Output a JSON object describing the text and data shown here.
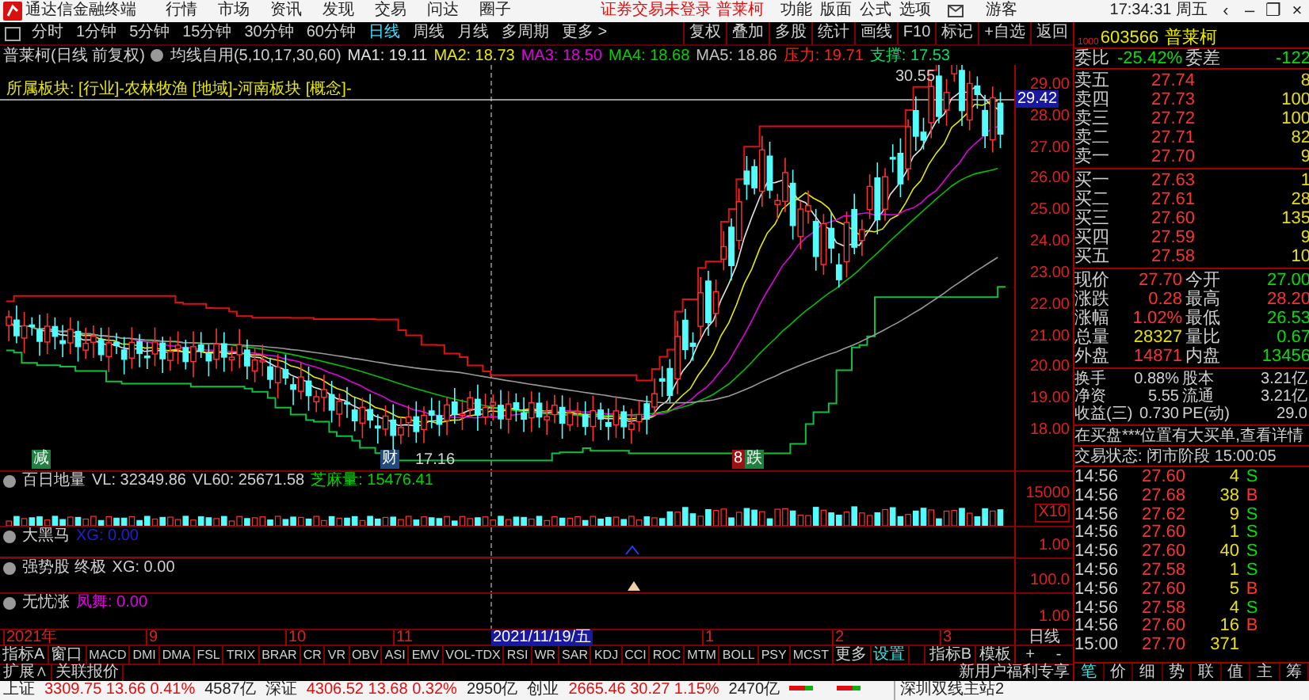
{
  "app_title": "通达信金融终端",
  "menu": [
    "行情",
    "市场",
    "资讯",
    "发现",
    "交易",
    "问达",
    "圈子"
  ],
  "login_notice": "证券交易未登录 普莱柯",
  "top_menu": [
    "功能",
    "版面",
    "公式",
    "选项"
  ],
  "user": "游客",
  "clock": "17:34:31 周五",
  "window_controls": [
    "‹",
    "–",
    "❐",
    "×"
  ],
  "periods": [
    {
      "label": "分时",
      "selected": false
    },
    {
      "label": "1分钟",
      "selected": false
    },
    {
      "label": "5分钟",
      "selected": false
    },
    {
      "label": "15分钟",
      "selected": false
    },
    {
      "label": "30分钟",
      "selected": false
    },
    {
      "label": "60分钟",
      "selected": false
    },
    {
      "label": "日线",
      "selected": true
    },
    {
      "label": "周线",
      "selected": false
    },
    {
      "label": "月线",
      "selected": false
    },
    {
      "label": "多周期",
      "selected": false
    },
    {
      "label": "更多 >",
      "selected": false
    }
  ],
  "chart_tools": [
    "复权",
    "叠加",
    "多股",
    "统计",
    "画线",
    "F10",
    "标记",
    "+自选",
    "返回"
  ],
  "chart_header": {
    "title": "普莱柯(日线 前复权)",
    "indicator": "均线自用(5,10,17,30,60)",
    "values": [
      {
        "text": "MA1: 19.11",
        "color": "#e0e0e0"
      },
      {
        "text": "MA2: 18.73",
        "color": "#e8e800"
      },
      {
        "text": "MA3: 18.50",
        "color": "#e000e0"
      },
      {
        "text": "MA4: 18.68",
        "color": "#00d000"
      },
      {
        "text": "MA5: 18.86",
        "color": "#c0c0c0"
      },
      {
        "text": "压力: 19.71",
        "color": "#ff2020"
      },
      {
        "text": "支撑: 17.53",
        "color": "#00e060"
      }
    ]
  },
  "sector_line": "所属板块: [行业]-农林牧渔 [地域]-河南板块 [概念]-",
  "price_axis": [
    "29.00",
    "28.00",
    "27.00",
    "26.00",
    "25.00",
    "24.00",
    "23.00",
    "22.00",
    "21.00",
    "20.00",
    "19.00",
    "18.00"
  ],
  "price_tag": "29.42",
  "high_label": "30.55",
  "low_label": "17.16",
  "event_marks": [
    {
      "text": "减",
      "color": "#208040"
    },
    {
      "text": "财",
      "color": "#204a80"
    },
    {
      "text": "8",
      "color": "#a01010"
    },
    {
      "text": "跌",
      "color": "#208040"
    }
  ],
  "panels": [
    {
      "name": "百日地量",
      "values": [
        {
          "text": "VL: 32349.86",
          "color": "#d0d0d0"
        },
        {
          "text": "VL60: 25671.58",
          "color": "#d0d0d0"
        },
        {
          "text": "芝麻量: 15476.41",
          "color": "#00d000"
        }
      ],
      "axis": [
        "15000",
        "X10"
      ]
    },
    {
      "name": "大黑马",
      "values": [
        {
          "text": "XG: 0.00",
          "color": "#2020d0"
        }
      ],
      "axis": [
        "1.00"
      ]
    },
    {
      "name": "强势股 终极",
      "values": [
        {
          "text": "XG: 0.00",
          "color": "#d0d0d0"
        }
      ],
      "axis": [
        "100.0"
      ]
    },
    {
      "name": "无忧涨",
      "values": [
        {
          "text": "凤舞: 0.00",
          "color": "#e000e0"
        }
      ],
      "axis": [
        "1.00"
      ]
    }
  ],
  "date_axis": [
    "2021年",
    "9",
    "10",
    "11",
    "1",
    "2",
    "3"
  ],
  "cursor_date": "2021/11/19/五",
  "axis_period": "日线",
  "zoom_buttons": [
    "+",
    "-"
  ],
  "indicator_tabs": [
    {
      "label": "指标A",
      "highlighted": false
    },
    {
      "label": "窗口",
      "highlighted": false
    },
    {
      "label": "MACD",
      "highlighted": false
    },
    {
      "label": "DMI",
      "highlighted": false
    },
    {
      "label": "DMA",
      "highlighted": false
    },
    {
      "label": "FSL",
      "highlighted": false
    },
    {
      "label": "TRIX",
      "highlighted": false
    },
    {
      "label": "BRAR",
      "highlighted": false
    },
    {
      "label": "CR",
      "highlighted": false
    },
    {
      "label": "VR",
      "highlighted": false
    },
    {
      "label": "OBV",
      "highlighted": false
    },
    {
      "label": "ASI",
      "highlighted": false
    },
    {
      "label": "EMV",
      "highlighted": false
    },
    {
      "label": "VOL-TDX",
      "highlighted": false
    },
    {
      "label": "RSI",
      "highlighted": false
    },
    {
      "label": "WR",
      "highlighted": false
    },
    {
      "label": "SAR",
      "highlighted": false
    },
    {
      "label": "KDJ",
      "highlighted": false
    },
    {
      "label": "CCI",
      "highlighted": false
    },
    {
      "label": "ROC",
      "highlighted": false
    },
    {
      "label": "MTM",
      "highlighted": false
    },
    {
      "label": "BOLL",
      "highlighted": false
    },
    {
      "label": "PSY",
      "highlighted": false
    },
    {
      "label": "MCST",
      "highlighted": false
    },
    {
      "label": "更多",
      "highlighted": false
    },
    {
      "label": "设置",
      "highlighted": true
    }
  ],
  "indicator_tabs_right": [
    "指标B",
    "模板"
  ],
  "extra_tabs": [
    "扩展∧",
    "关联报价"
  ],
  "promo": "新用户福利专享",
  "stock": {
    "badge": "1000",
    "code": "603566",
    "name": "普莱柯"
  },
  "ratio": {
    "label": "委比",
    "value": "-25.42%",
    "label2": "委差",
    "value2": "-122"
  },
  "asks": [
    {
      "label": "卖五",
      "price": "27.74",
      "volume": "8"
    },
    {
      "label": "卖四",
      "price": "27.73",
      "volume": "100"
    },
    {
      "label": "卖三",
      "price": "27.72",
      "volume": "100"
    },
    {
      "label": "卖二",
      "price": "27.71",
      "volume": "82"
    },
    {
      "label": "卖一",
      "price": "27.70",
      "volume": "9"
    }
  ],
  "bids": [
    {
      "label": "买一",
      "price": "27.63",
      "volume": "1"
    },
    {
      "label": "买二",
      "price": "27.61",
      "volume": "28"
    },
    {
      "label": "买三",
      "price": "27.60",
      "volume": "135"
    },
    {
      "label": "买四",
      "price": "27.59",
      "volume": "9"
    },
    {
      "label": "买五",
      "price": "27.58",
      "volume": "10"
    }
  ],
  "stats": [
    {
      "cells": [
        {
          "label": "现价",
          "value": "27.70",
          "color": "#ff3030"
        },
        {
          "label": "今开",
          "value": "27.00",
          "color": "#00e000"
        }
      ]
    },
    {
      "cells": [
        {
          "label": "涨跌",
          "value": "0.28",
          "color": "#ff3030"
        },
        {
          "label": "最高",
          "value": "28.20",
          "color": "#ff3030"
        }
      ]
    },
    {
      "cells": [
        {
          "label": "涨幅",
          "value": "1.02%",
          "color": "#ff3030"
        },
        {
          "label": "最低",
          "value": "26.53",
          "color": "#00e000"
        }
      ]
    },
    {
      "cells": [
        {
          "label": "总量",
          "value": "28327",
          "color": "#e8e000"
        },
        {
          "label": "量比",
          "value": "0.67",
          "color": "#00e000"
        }
      ]
    },
    {
      "cells": [
        {
          "label": "外盘",
          "value": "14871",
          "color": "#ff3030"
        },
        {
          "label": "内盘",
          "value": "13456",
          "color": "#00e000"
        }
      ]
    }
  ],
  "fundamentals": [
    {
      "label": "换手",
      "value": "0.88%",
      "label2": "股本",
      "value2": "3.21亿"
    },
    {
      "label": "净资",
      "value": "5.55",
      "label2": "流通",
      "value2": "3.21亿"
    },
    {
      "label": "收益(三)",
      "value": "0.730",
      "label2": "PE(动)",
      "value2": "29.0"
    }
  ],
  "notice": "在买盘***位置有大买单,查看详情",
  "trade_status": "交易状态: 闭市阶段 15:00:05",
  "ticks": [
    {
      "time": "14:56",
      "price": "27.60",
      "volume": "4",
      "side": "S"
    },
    {
      "time": "14:56",
      "price": "27.68",
      "volume": "38",
      "side": "B"
    },
    {
      "time": "14:56",
      "price": "27.62",
      "volume": "9",
      "side": "S"
    },
    {
      "time": "14:56",
      "price": "27.60",
      "volume": "1",
      "side": "S"
    },
    {
      "time": "14:56",
      "price": "27.60",
      "volume": "40",
      "side": "S"
    },
    {
      "time": "14:56",
      "price": "27.58",
      "volume": "1",
      "side": "S"
    },
    {
      "time": "14:56",
      "price": "27.60",
      "volume": "5",
      "side": "B"
    },
    {
      "time": "14:56",
      "price": "27.58",
      "volume": "4",
      "side": "S"
    },
    {
      "time": "14:56",
      "price": "27.60",
      "volume": "16",
      "side": "B"
    },
    {
      "time": "15:00",
      "price": "27.70",
      "volume": "371"
    }
  ],
  "tick_tabs": [
    {
      "label": "笔",
      "selected": true
    },
    {
      "label": "价",
      "selected": false
    },
    {
      "label": "细",
      "selected": false
    },
    {
      "label": "势",
      "selected": false
    },
    {
      "label": "联",
      "selected": false
    },
    {
      "label": "值",
      "selected": false
    },
    {
      "label": "主",
      "selected": false
    },
    {
      "label": "筹",
      "selected": false
    }
  ],
  "status_indices": [
    {
      "name": "上证",
      "value": "3309.75 13.66 0.41%",
      "amount": "4587亿"
    },
    {
      "name": "深证",
      "value": "4306.52 13.68 0.32%",
      "amount": "2950亿"
    },
    {
      "name": "创业",
      "value": "2665.46 30.27 1.15%",
      "amount": "2470亿"
    }
  ],
  "server": "深圳双线主站2"
}
